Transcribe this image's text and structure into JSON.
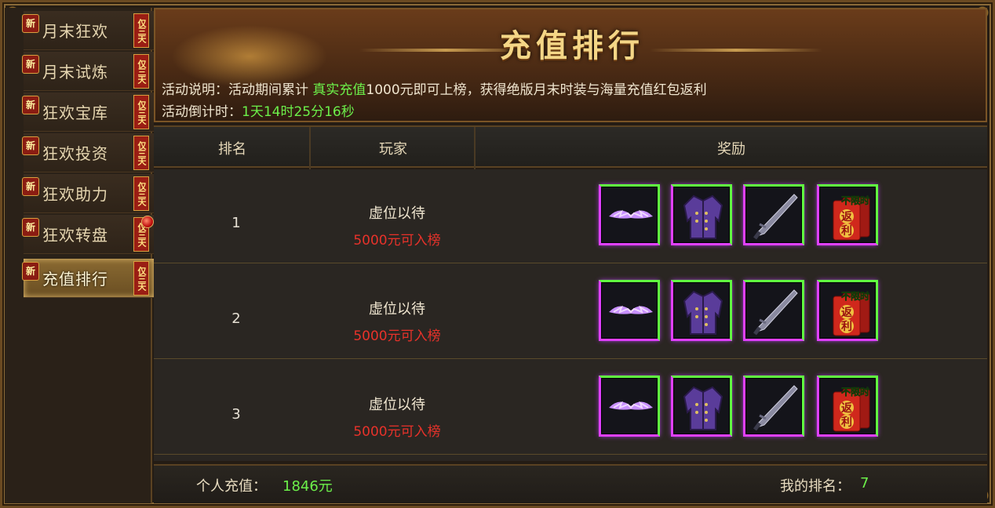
{
  "sidebar": {
    "new_badge": "新",
    "only_badge": "仅三天",
    "items": [
      {
        "label": "月末狂欢"
      },
      {
        "label": "月末试炼"
      },
      {
        "label": "狂欢宝库"
      },
      {
        "label": "狂欢投资"
      },
      {
        "label": "狂欢助力"
      },
      {
        "label": "狂欢转盘"
      },
      {
        "label": "充值排行"
      }
    ],
    "active_index": 6
  },
  "banner": {
    "title": "充值排行",
    "desc_prefix": "活动说明：活动期间累计 ",
    "desc_highlight": "真实充值",
    "desc_suffix": "1000元即可上榜，获得绝版月末时装与海量充值红包返利",
    "countdown_label": "活动倒计时：",
    "countdown_value": "1天14时25分16秒"
  },
  "table": {
    "headers": {
      "rank": "排名",
      "player": "玩家",
      "reward": "奖励"
    },
    "rows": [
      {
        "rank": "1",
        "player": "虚位以待",
        "requirement": "5000元可入榜"
      },
      {
        "rank": "2",
        "player": "虚位以待",
        "requirement": "5000元可入榜"
      },
      {
        "rank": "3",
        "player": "虚位以待",
        "requirement": "5000元可入榜"
      }
    ],
    "reward_items": [
      "wing-icon",
      "coat-icon",
      "sword-icon",
      "red-envelope-icon"
    ],
    "red_envelope_text": {
      "top": "不限时",
      "a": "返",
      "b": "利"
    }
  },
  "footer": {
    "personal_label": "个人充值：",
    "personal_value": "1846元",
    "my_rank_label": "我的排名：",
    "my_rank_value": "7"
  },
  "colors": {
    "highlight_green": "#6cf04a",
    "requirement_red": "#e8322a",
    "gold": "#f4d686"
  }
}
